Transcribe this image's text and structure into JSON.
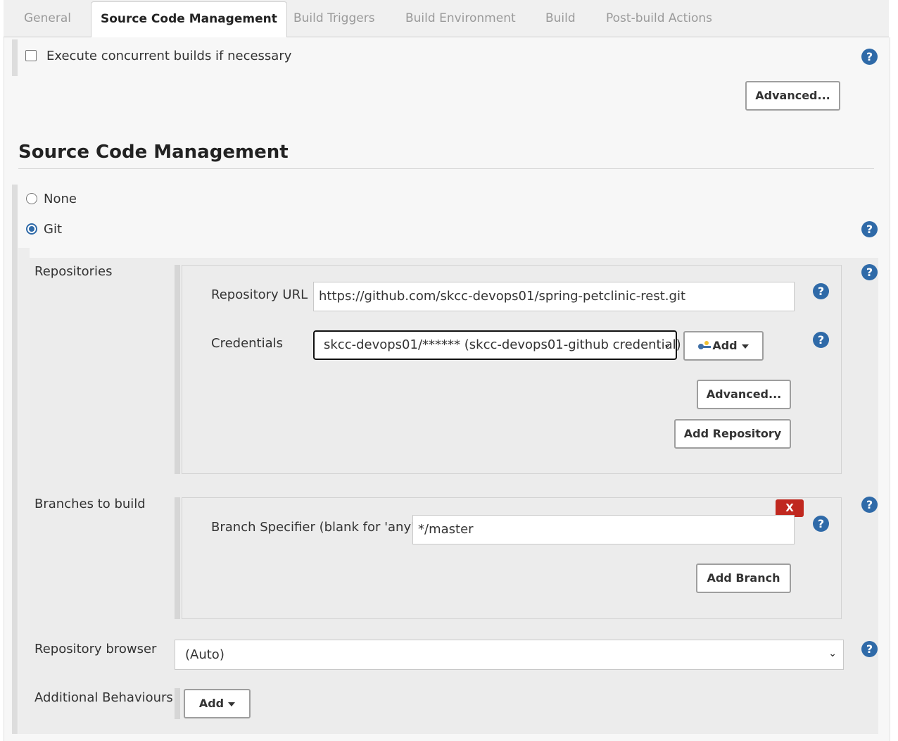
{
  "tabs": [
    {
      "label": "General"
    },
    {
      "label": "Source Code Management"
    },
    {
      "label": "Build Triggers"
    },
    {
      "label": "Build Environment"
    },
    {
      "label": "Build"
    },
    {
      "label": "Post-build Actions"
    }
  ],
  "general": {
    "concurrent_label": "Execute concurrent builds if necessary",
    "concurrent_checked": false,
    "advanced_label": "Advanced..."
  },
  "scm": {
    "heading": "Source Code Management",
    "options": [
      {
        "label": "None",
        "selected": false
      },
      {
        "label": "Git",
        "selected": true
      }
    ],
    "repositories": {
      "label": "Repositories",
      "url_label": "Repository URL",
      "url_value": "https://github.com/skcc-devops01/spring-petclinic-rest.git",
      "credentials_label": "Credentials",
      "credentials_value": "skcc-devops01/****** (skcc-devops01-github credential)",
      "add_label": "Add",
      "advanced_label": "Advanced...",
      "add_repository_label": "Add Repository"
    },
    "branches": {
      "label": "Branches to build",
      "delete_label": "X",
      "specifier_label": "Branch Specifier (blank for 'any')",
      "specifier_value": "*/master",
      "add_branch_label": "Add Branch"
    },
    "browser": {
      "label": "Repository browser",
      "value": "(Auto)"
    },
    "behaviours": {
      "label": "Additional Behaviours",
      "add_label": "Add"
    }
  },
  "colors": {
    "help": "#2f6aa8",
    "delete": "#c0281f"
  },
  "icons": [
    "help-icon",
    "key-icon",
    "dropdown-caret-icon",
    "chevron-down-icon"
  ]
}
